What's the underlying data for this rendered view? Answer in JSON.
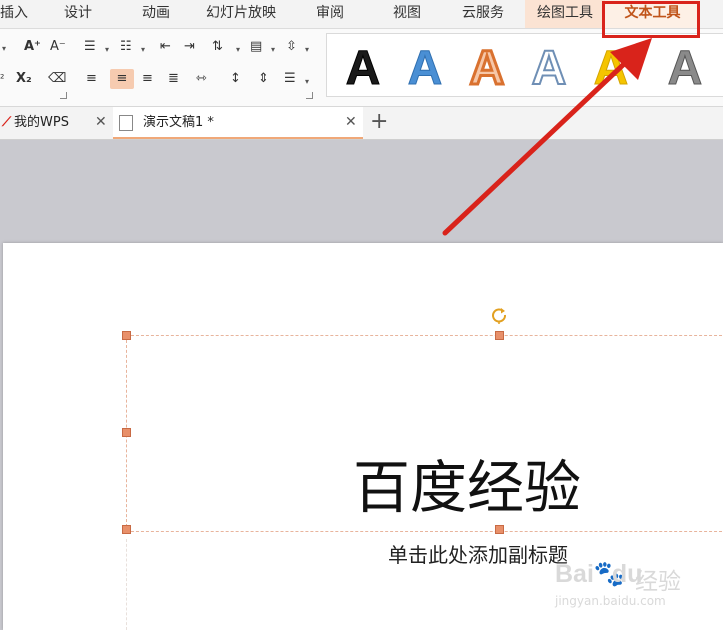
{
  "menubar": {
    "items": [
      "插入",
      "设计",
      "动画",
      "幻灯片放映",
      "审阅",
      "视图",
      "云服务"
    ],
    "items_visible_text": [
      "插入"
    ],
    "tool_tabs": {
      "drawing": "绘图工具",
      "text": "文本工具"
    }
  },
  "ribbon": {
    "font": {
      "grow": "A⁺",
      "shrink": "A⁻",
      "superscript": "²",
      "subscript": "X₂"
    },
    "wordart_styles": [
      {
        "name": "black-fill",
        "fill": "#1a1a1a",
        "stroke": "#000000"
      },
      {
        "name": "blue-gradient",
        "fill": "#4a8fd4",
        "stroke": "#2f6fb0"
      },
      {
        "name": "orange-outline",
        "fill": "#f6c7a8",
        "stroke": "#d9712f"
      },
      {
        "name": "blue-outline",
        "fill": "#ffffff",
        "stroke": "#6f8fb5"
      },
      {
        "name": "gold-fill",
        "fill": "#f5c400",
        "stroke": "#d4a500"
      },
      {
        "name": "gray-gradient",
        "fill": "#8a8a8a",
        "stroke": "#555555"
      }
    ]
  },
  "tabs": {
    "wps": {
      "label": "我的WPS"
    },
    "doc": {
      "label": "演示文稿1 *"
    }
  },
  "slide": {
    "title": "百度经验",
    "subtitle": "单击此处添加副标题"
  },
  "watermark": {
    "logo": "Bai",
    "logo2": "du",
    "name": "经验",
    "url": "jingyan.baidu.com"
  },
  "colors": {
    "accent": "#c0541a",
    "highlight": "#d9231b",
    "handle": "#e8906a"
  }
}
